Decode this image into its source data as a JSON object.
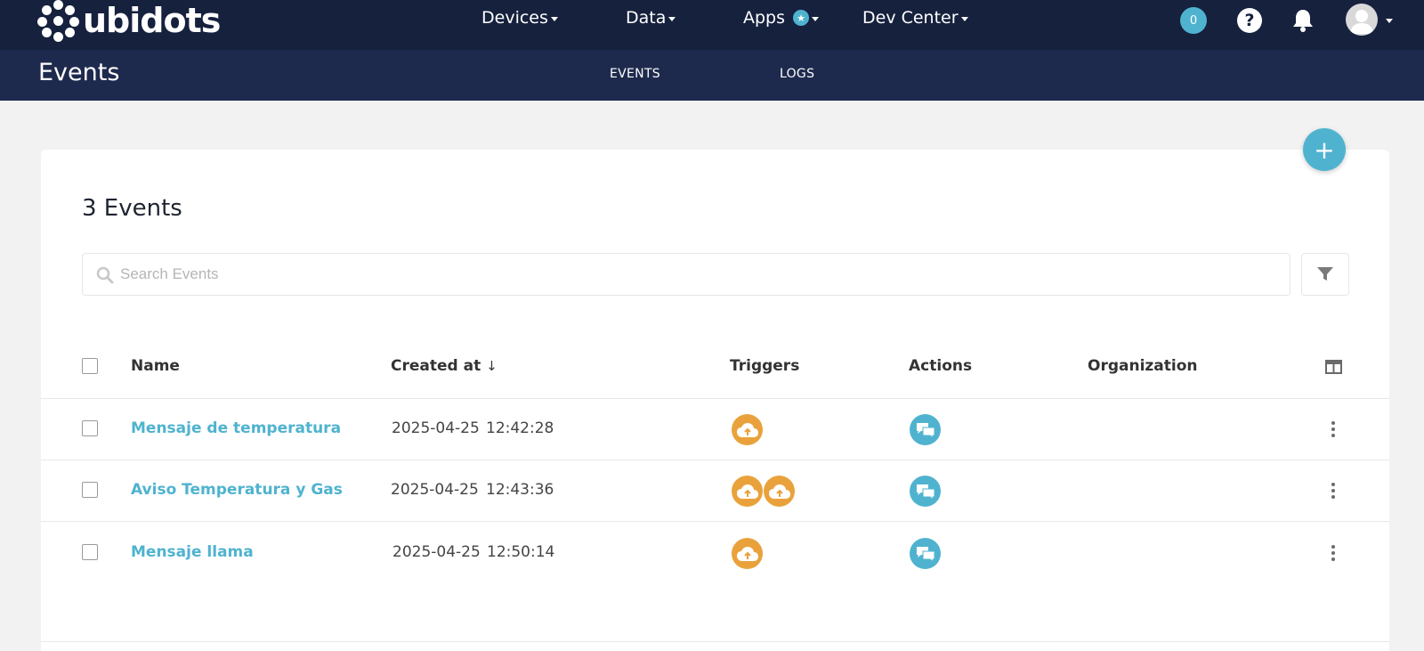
{
  "brand": {
    "logo_text": "ubidots"
  },
  "topnav": {
    "items": [
      {
        "label": "Devices"
      },
      {
        "label": "Data"
      },
      {
        "label": "Apps"
      },
      {
        "label": "Dev Center"
      }
    ],
    "notification_count": "0",
    "help_label": "?"
  },
  "subheader": {
    "title": "Events",
    "tabs": [
      {
        "label": "EVENTS"
      },
      {
        "label": "LOGS"
      }
    ]
  },
  "events_panel": {
    "heading": "3 Events",
    "search_placeholder": "Search Events",
    "add_label": "+",
    "columns": {
      "name": "Name",
      "created_at": "Created at",
      "sort_indicator": "↓",
      "triggers": "Triggers",
      "actions": "Actions",
      "organization": "Organization"
    },
    "rows": [
      {
        "name": "Mensaje de temperatura",
        "date": "2025-04-25",
        "time": "12:42:28",
        "trigger_count": 1,
        "action_count": 1,
        "organization": ""
      },
      {
        "name": "Aviso Temperatura y Gas",
        "date": "2025-04-25",
        "time": "12:43:36",
        "trigger_count": 2,
        "action_count": 1,
        "organization": ""
      },
      {
        "name": "Mensaje llama",
        "date": "2025-04-25",
        "time": "12:50:14",
        "trigger_count": 1,
        "action_count": 1,
        "organization": ""
      }
    ]
  },
  "colors": {
    "topbar": "#16213e",
    "subbar": "#1e2a4d",
    "accent": "#4fb3cf",
    "trigger": "#e9a23b"
  },
  "icons": {
    "trigger": "cloud-upload-icon",
    "action": "chat-bubbles-icon",
    "filter": "filter-icon",
    "search": "search-icon",
    "columns": "columns-icon",
    "row_menu": "kebab-menu-icon"
  }
}
